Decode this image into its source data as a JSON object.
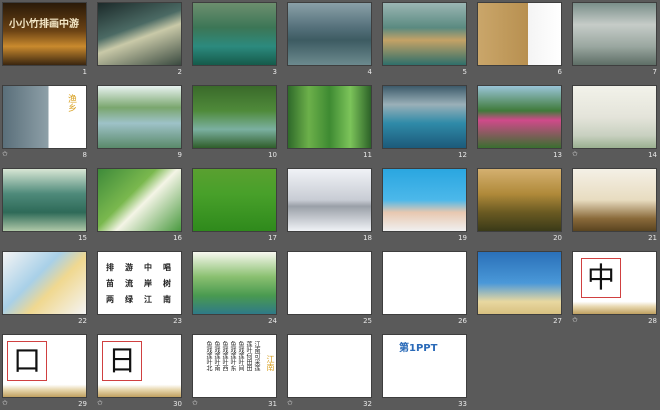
{
  "window": {
    "view": "Slide Sorter"
  },
  "colors": {
    "background": "#5a5a5a",
    "number_text": "#e8e8e8"
  },
  "slides": [
    {
      "number": "1",
      "title": "小小竹排画中游",
      "animated": false
    },
    {
      "number": "2",
      "animated": false
    },
    {
      "number": "3",
      "animated": false
    },
    {
      "number": "4",
      "animated": false
    },
    {
      "number": "5",
      "animated": false
    },
    {
      "number": "6",
      "animated": false
    },
    {
      "number": "7",
      "animated": false
    },
    {
      "number": "8",
      "title": "渔乡",
      "animated": true
    },
    {
      "number": "9",
      "animated": false
    },
    {
      "number": "10",
      "animated": false
    },
    {
      "number": "11",
      "animated": false
    },
    {
      "number": "12",
      "animated": false
    },
    {
      "number": "13",
      "animated": false
    },
    {
      "number": "14",
      "animated": true
    },
    {
      "number": "15",
      "animated": false
    },
    {
      "number": "16",
      "animated": false
    },
    {
      "number": "17",
      "animated": false
    },
    {
      "number": "18",
      "animated": false
    },
    {
      "number": "19",
      "animated": false
    },
    {
      "number": "20",
      "animated": false
    },
    {
      "number": "21",
      "animated": false
    },
    {
      "number": "22",
      "animated": false
    },
    {
      "number": "23",
      "animated": false,
      "words": [
        "排",
        "游",
        "中",
        "唱",
        "苗",
        "流",
        "岸",
        "树",
        "两",
        "绿",
        "江",
        "南"
      ]
    },
    {
      "number": "24",
      "animated": false
    },
    {
      "number": "25",
      "animated": false
    },
    {
      "number": "26",
      "animated": false
    },
    {
      "number": "27",
      "animated": false
    },
    {
      "number": "28",
      "char": "中",
      "animated": true
    },
    {
      "number": "29",
      "char": "口",
      "animated": true
    },
    {
      "number": "30",
      "char": "日",
      "animated": true
    },
    {
      "number": "31",
      "animated": true,
      "columns": [
        "江南可采莲",
        "莲叶何田田",
        "鱼戏莲叶间",
        "鱼戏莲叶东",
        "鱼戏莲叶西",
        "鱼戏莲叶南",
        "鱼戏莲叶北"
      ],
      "side_title": "江南"
    },
    {
      "number": "32",
      "animated": true
    },
    {
      "number": "33",
      "title": "第1PPT",
      "animated": false
    }
  ],
  "animation_icon": "star-icon",
  "animation_glyph": "✩"
}
